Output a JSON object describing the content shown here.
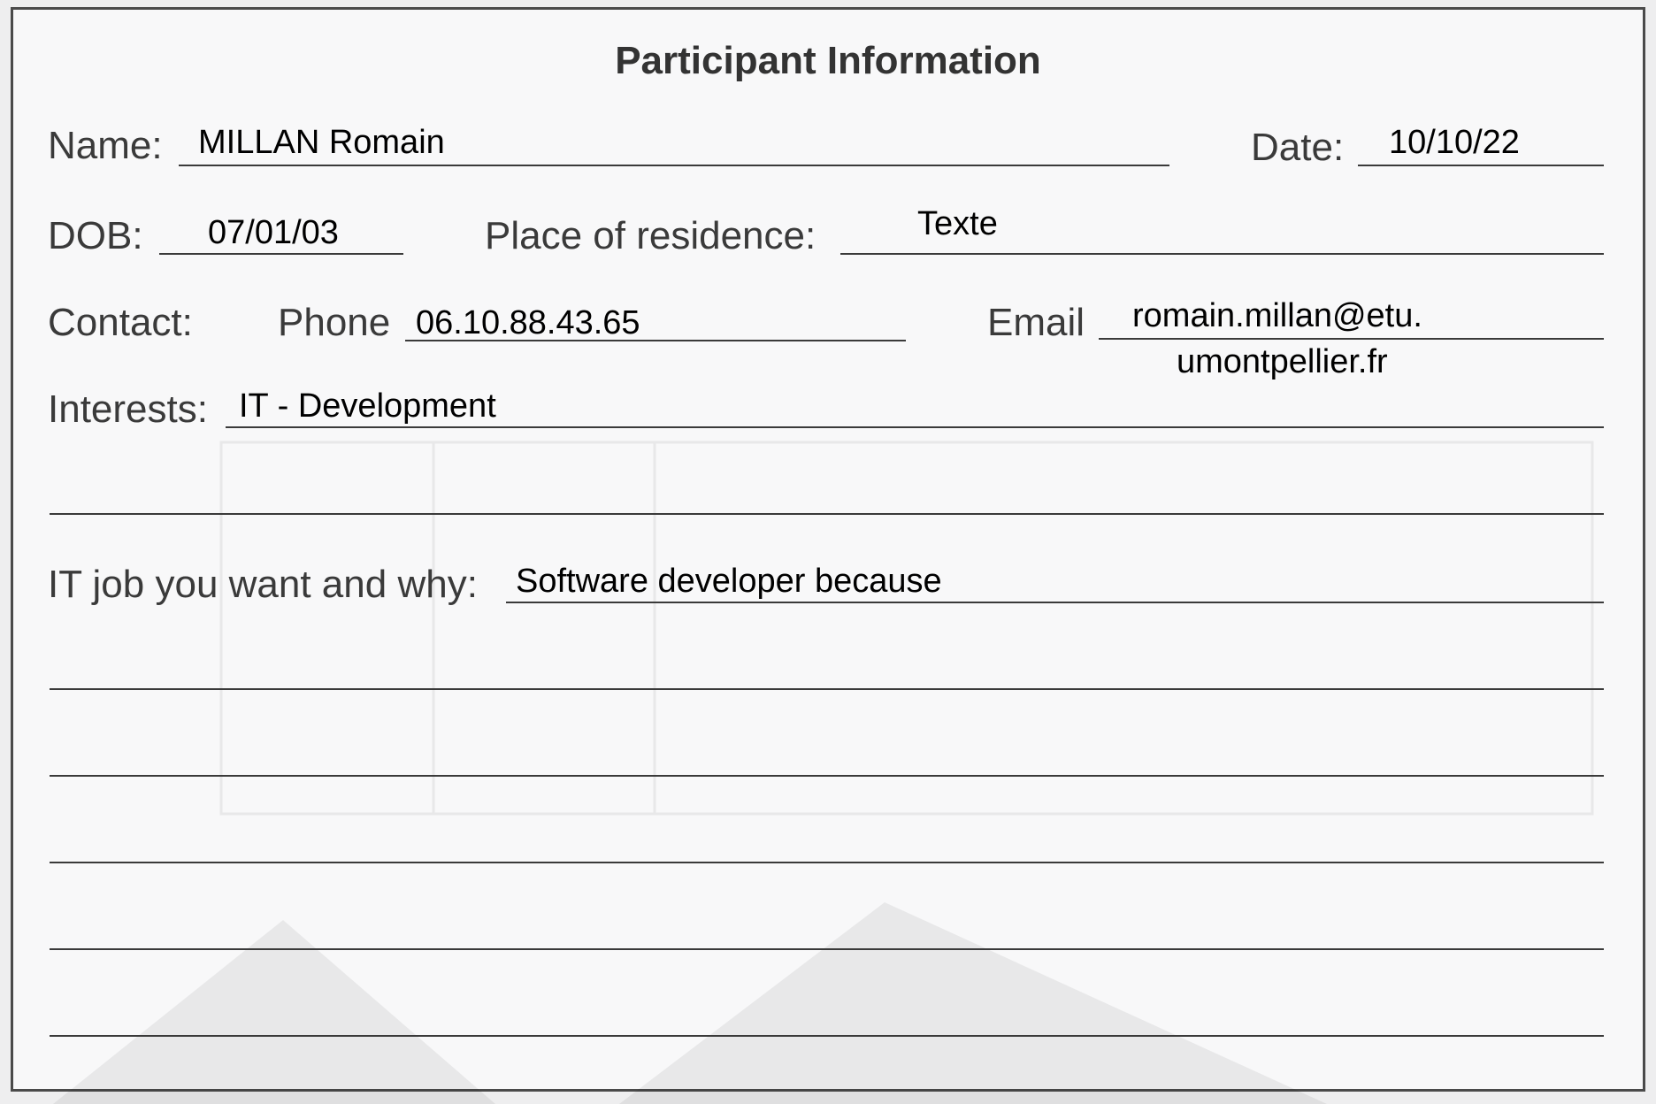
{
  "form": {
    "title": "Participant Information",
    "labels": {
      "name": "Name:",
      "date": "Date:",
      "dob": "DOB:",
      "residence": "Place of residence:",
      "contact": "Contact:",
      "phone": "Phone",
      "email": "Email",
      "interests": "Interests:",
      "job": "IT job you want and why:"
    },
    "values": {
      "name": "MILLAN Romain",
      "date": "10/10/22",
      "dob": "07/01/03",
      "residence": "Texte",
      "phone": "06.10.88.43.65",
      "email_line1": "romain.millan@etu.",
      "email_line2": "umontpellier.fr",
      "interests": "IT - Development",
      "job": "Software developer because"
    }
  },
  "colors": {
    "printed_text": "#3a3a3a",
    "typed_text": "#000000",
    "card_background": "#f8f8f9",
    "border": "#4a4a4a"
  }
}
